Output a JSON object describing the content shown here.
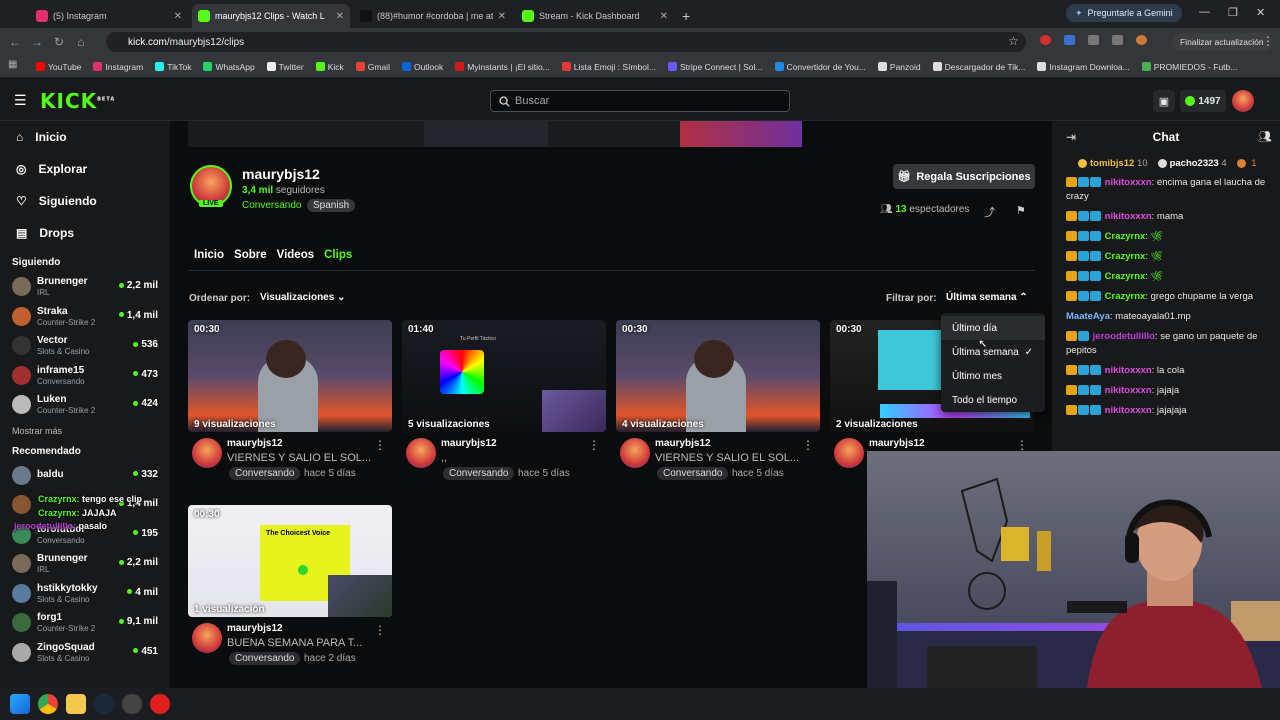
{
  "browser": {
    "tabs": [
      {
        "label": "(5) Instagram",
        "color": "#e1306c"
      },
      {
        "label": "maurybjs12 Clips - Watch L",
        "color": "#53fc18"
      },
      {
        "label": "(88)#humor #cordoba | me ato",
        "color": "#111111"
      },
      {
        "label": "Stream - Kick Dashboard",
        "color": "#53fc18"
      }
    ],
    "url_domain": "kick.com",
    "url_path": "/maurybjs12/clips",
    "gemini": "Preguntarle a Gemini",
    "update": "Finalizar actualización",
    "bookmarks": [
      {
        "label": "YouTube",
        "color": "#ff0000"
      },
      {
        "label": "Instagram",
        "color": "#e1306c"
      },
      {
        "label": "TikTok",
        "color": "#25f4ee"
      },
      {
        "label": "WhatsApp",
        "color": "#25d366"
      },
      {
        "label": "Twitter",
        "color": "#eeeeee"
      },
      {
        "label": "Kick",
        "color": "#53fc18"
      },
      {
        "label": "Gmail",
        "color": "#ea4335"
      },
      {
        "label": "Outlook",
        "color": "#0a64d6"
      },
      {
        "label": "Myinstants | ¡El sitio...",
        "color": "#d11a1a"
      },
      {
        "label": "Lista Emoji : Símbol...",
        "color": "#e53935"
      },
      {
        "label": "Stripe Connect | Sol...",
        "color": "#635bff"
      },
      {
        "label": "Convertidor de You...",
        "color": "#1e88e5"
      },
      {
        "label": "Panzoid",
        "color": "#dddddd"
      },
      {
        "label": "Descargador de Tik...",
        "color": "#dddddd"
      },
      {
        "label": "Instagram Downloa...",
        "color": "#dddddd"
      },
      {
        "label": "PROMIEDOS - Futb...",
        "color": "#4caf50"
      }
    ]
  },
  "kick": {
    "logo": "KICK",
    "beta": "BETA",
    "search_placeholder": "Buscar",
    "coins": "1497",
    "accent": "#53fc18"
  },
  "sidebar": {
    "nav": [
      "Inicio",
      "Explorar",
      "Siguiendo",
      "Drops"
    ],
    "following_title": "Siguiendo",
    "following": [
      {
        "name": "Brunenger",
        "cat": "IRL",
        "viewers": "2,2 mil",
        "color": "#7a6a5a"
      },
      {
        "name": "Straka",
        "cat": "Counter-Strike 2",
        "viewers": "1,4 mil",
        "color": "#c06030"
      },
      {
        "name": "Vector",
        "cat": "Slots & Casino",
        "viewers": "536",
        "color": "#333333"
      },
      {
        "name": "inframe15",
        "cat": "Conversando",
        "viewers": "473",
        "color": "#a03030"
      },
      {
        "name": "Luken",
        "cat": "Counter-Strike 2",
        "viewers": "424",
        "color": "#bbbbbb"
      }
    ],
    "more": "Mostrar más",
    "recommended_title": "Recomendado",
    "recommended": [
      {
        "name": "baldu",
        "cat": "",
        "viewers": "332",
        "color": "#6a7a8a"
      },
      {
        "name": "",
        "cat": "",
        "viewers": "1,4 mil",
        "color": "#885533"
      },
      {
        "name": "torofutbol",
        "cat": "Conversando",
        "viewers": "195",
        "color": "#3a8a5a"
      },
      {
        "name": "Brunenger",
        "cat": "IRL",
        "viewers": "2,2 mil",
        "color": "#7a6a5a"
      },
      {
        "name": "hstikkytokky",
        "cat": "Slots & Casino",
        "viewers": "4 mil",
        "color": "#5a7aa0"
      },
      {
        "name": "forg1",
        "cat": "Counter-Strike 2",
        "viewers": "9,1 mil",
        "color": "#3a6a3a"
      },
      {
        "name": "ZingoSquad",
        "cat": "Slots & Casino",
        "viewers": "451",
        "color": "#aaaaaa"
      }
    ],
    "overlay": [
      {
        "user": "Crazyrnx:",
        "text": "tengo ese clip"
      },
      {
        "user": "Crazyrnx:",
        "text": "JAJAJA"
      },
      {
        "user": "jeroodetullillo:",
        "text": "pasalo"
      }
    ]
  },
  "channel": {
    "name": "maurybjs12",
    "followers": "3,4 mil",
    "followers_label": "seguidores",
    "category": "Conversando",
    "language": "Spanish",
    "live": "LIVE",
    "gift_button": "Regala Suscripciones",
    "viewers": "13",
    "viewers_label": "espectadores",
    "tabs": [
      "Inicio",
      "Sobre",
      "Videos",
      "Clips"
    ],
    "active_tab": 3
  },
  "clips_bar": {
    "sort_label": "Ordenar por:",
    "sort_value": "Visualizaciones",
    "filter_label": "Filtrar por:",
    "filter_value": "Última semana",
    "filter_options": [
      "Último día",
      "Última semana",
      "Último mes",
      "Todo el tiempo"
    ],
    "filter_selected": 1
  },
  "clips": [
    {
      "duration": "00:30",
      "views": "9 visualizaciones",
      "channel": "maurybjs12",
      "title": "VIERNES Y SALIO EL SOL...",
      "category": "Conversando",
      "ago": "hace 5 días"
    },
    {
      "duration": "01:40",
      "views": "5 visualizaciones",
      "channel": "maurybjs12",
      "title": ",,",
      "category": "Conversando",
      "ago": "hace 5 días"
    },
    {
      "duration": "00:30",
      "views": "4 visualizaciones",
      "channel": "maurybjs12",
      "title": "VIERNES Y SALIO EL SOL...",
      "category": "Conversando",
      "ago": "hace 5 días"
    },
    {
      "duration": "00:30",
      "views": "2 visualizaciones",
      "channel": "maurybjs12",
      "title": "",
      "category": "",
      "ago": ""
    },
    {
      "duration": "00:30",
      "views": "1 visualización",
      "channel": "maurybjs12",
      "title": "BUENA SEMANA PARA T...",
      "category": "Conversando",
      "ago": "hace 2 días"
    }
  ],
  "clip_screen_text": {
    "palette": "Tu Perfil Táctico",
    "chosen": "The Choicest Voice"
  },
  "chat": {
    "title": "Chat",
    "top": [
      {
        "user": "tomibjs12",
        "count": "10",
        "color": "#f0c040"
      },
      {
        "user": "pacho2323",
        "count": "4",
        "color": "#dddddd"
      },
      {
        "user": "",
        "count": "1",
        "color": "#e08030"
      }
    ],
    "messages": [
      {
        "user": "nikitoxxxn",
        "text": "encima gana el laucha de crazy",
        "color": "#e04be0",
        "badges": 3
      },
      {
        "user": "nikitoxxxn",
        "text": "mama",
        "color": "#e04be0",
        "badges": 3
      },
      {
        "user": "Crazyrnx",
        "text": "",
        "color": "#53fc18",
        "badges": 3,
        "emote": true
      },
      {
        "user": "Crazyrnx",
        "text": "",
        "color": "#53fc18",
        "badges": 3,
        "emote": true
      },
      {
        "user": "Crazyrnx",
        "text": "",
        "color": "#53fc18",
        "badges": 3,
        "emote": true
      },
      {
        "user": "Crazyrnx",
        "text": "grego chupame la verga",
        "color": "#53fc18",
        "badges": 3
      },
      {
        "user": "MaateAya",
        "text": "mateoayala01.mp",
        "color": "#7ab8ff",
        "badges": 0
      },
      {
        "user": "jeroodetullillo",
        "text": "se gano un paquete de pepitos",
        "color": "#c03bd8",
        "badges": 2
      },
      {
        "user": "nikitoxxxn",
        "text": "la cola",
        "color": "#e04be0",
        "badges": 3
      },
      {
        "user": "nikitoxxxn",
        "text": "jajaja",
        "color": "#e04be0",
        "badges": 3
      },
      {
        "user": "nikitoxxxn",
        "text": "jajajaja",
        "color": "#e04be0",
        "badges": 3
      }
    ]
  }
}
